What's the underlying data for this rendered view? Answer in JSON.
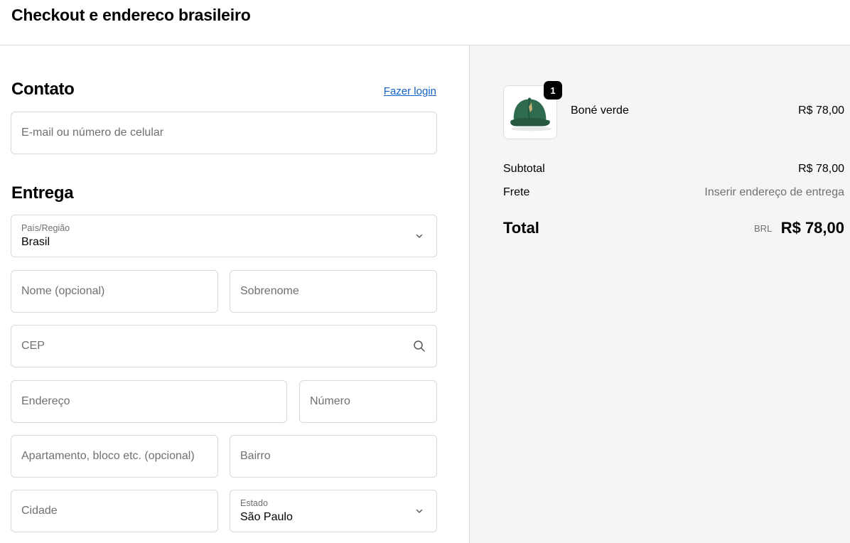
{
  "page": {
    "title": "Checkout e endereco brasileiro"
  },
  "contact": {
    "title": "Contato",
    "login_link": "Fazer login",
    "email_placeholder": "E-mail ou número de celular"
  },
  "delivery": {
    "title": "Entrega",
    "country": {
      "label": "País/Região",
      "value": "Brasil"
    },
    "first_name_placeholder": "Nome (opcional)",
    "last_name_placeholder": "Sobrenome",
    "cep_placeholder": "CEP",
    "address_placeholder": "Endereço",
    "number_placeholder": "Número",
    "apartment_placeholder": "Apartamento, bloco etc. (opcional)",
    "neighborhood_placeholder": "Bairro",
    "city_placeholder": "Cidade",
    "state": {
      "label": "Estado",
      "value": "São Paulo"
    }
  },
  "order": {
    "item": {
      "name": "Boné verde",
      "price": "R$ 78,00",
      "quantity": "1",
      "image_icon": "green-cap-image"
    },
    "subtotal_label": "Subtotal",
    "subtotal_value": "R$ 78,00",
    "shipping_label": "Frete",
    "shipping_value": "Inserir endereço de entrega",
    "total_label": "Total",
    "total_currency": "BRL",
    "total_value": "R$ 78,00"
  },
  "colors": {
    "link": "#1463c9",
    "summary_bg": "#f5f5f5",
    "cap_green": "#2f6b4f"
  }
}
